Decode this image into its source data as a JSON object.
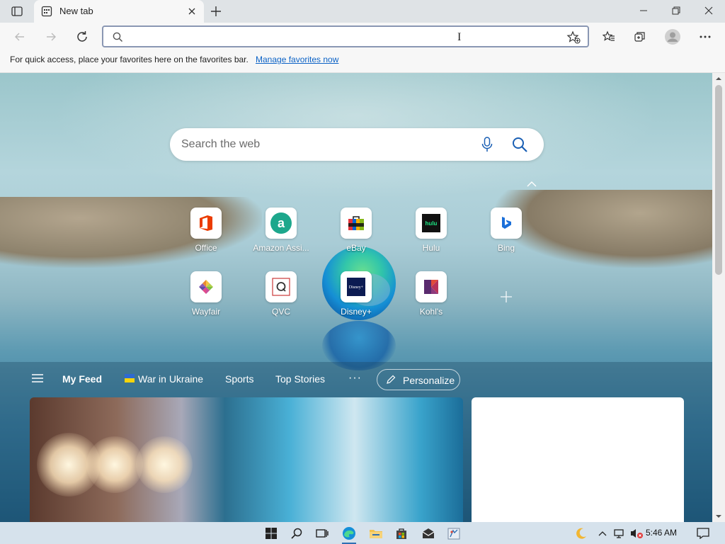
{
  "tab": {
    "title": "New tab"
  },
  "address": {
    "value": "",
    "placeholder": ""
  },
  "favorites_bar": {
    "message": "For quick access, place your favorites here on the favorites bar.",
    "link": "Manage favorites now"
  },
  "search": {
    "placeholder": "Search the web"
  },
  "quick_links": [
    {
      "label": "Office"
    },
    {
      "label": "Amazon Assi..."
    },
    {
      "label": "eBay"
    },
    {
      "label": "Hulu"
    },
    {
      "label": "Bing"
    },
    {
      "label": "Wayfair"
    },
    {
      "label": "QVC"
    },
    {
      "label": "Disney+"
    },
    {
      "label": "Kohl's"
    }
  ],
  "feed_nav": {
    "my_feed": "My Feed",
    "war": "War in Ukraine",
    "sports": "Sports",
    "top_stories": "Top Stories",
    "more": "···",
    "personalize": "Personalize"
  },
  "taskbar": {
    "time": "5:46 AM"
  },
  "colors": {
    "accent": "#0b62c6",
    "address_border": "#8a97b3",
    "taskbar": "#d6e2ec"
  }
}
